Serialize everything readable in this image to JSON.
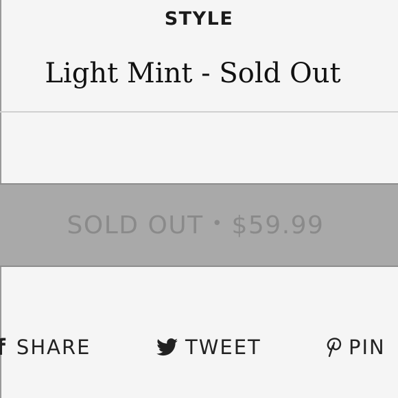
{
  "product": {
    "style_label": "STYLE",
    "style_value": "Light Mint - Sold Out"
  },
  "purchase_button": {
    "status": "SOLD OUT",
    "separator": "•",
    "price": "$59.99",
    "color": "#a9a9a9",
    "text_color": "#8a8a8a"
  },
  "share": {
    "facebook": {
      "icon": "facebook-icon",
      "label": "SHARE"
    },
    "twitter": {
      "icon": "twitter-bird-icon",
      "label": "TWEET"
    },
    "pinterest": {
      "icon": "pinterest-icon",
      "label": "PIN"
    }
  }
}
